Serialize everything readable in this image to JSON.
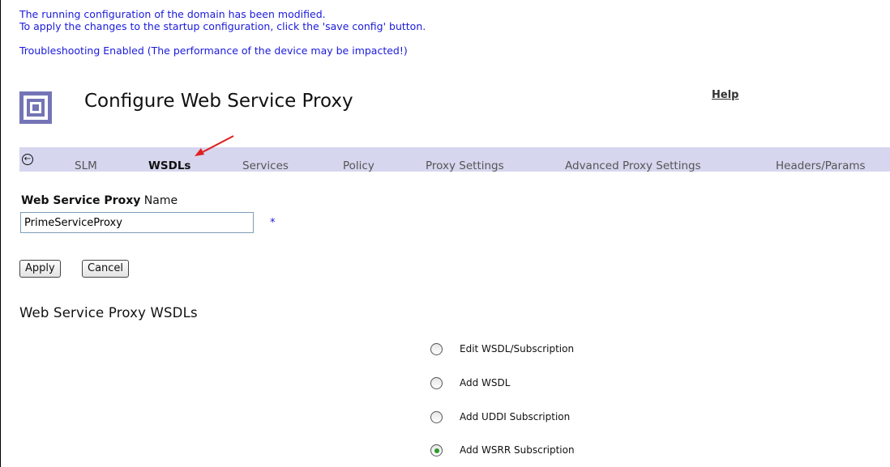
{
  "messages": {
    "line1": "The running configuration of the domain has been modified.",
    "line2": "To apply the changes to the startup configuration, click the 'save config' button.",
    "line3": "Troubleshooting Enabled (The performance of the device may be impacted!)"
  },
  "header": {
    "title": "Configure Web Service Proxy",
    "help": "Help"
  },
  "tabs": [
    {
      "label": "SLM",
      "active": false
    },
    {
      "label": "WSDLs",
      "active": true
    },
    {
      "label": "Services",
      "active": false
    },
    {
      "label": "Policy",
      "active": false
    },
    {
      "label": "Proxy Settings",
      "active": false
    },
    {
      "label": "Advanced Proxy Settings",
      "active": false
    },
    {
      "label": "Headers/Params",
      "active": false
    }
  ],
  "back_icon": "back-arrow-icon",
  "form": {
    "label_bold": "Web Service Proxy",
    "label_rest": " Name",
    "name_value": "PrimeServiceProxy",
    "required_mark": "*"
  },
  "buttons": {
    "apply": "Apply",
    "cancel": "Cancel"
  },
  "section": {
    "title": "Web Service Proxy WSDLs"
  },
  "options": [
    {
      "label": "Edit WSDL/Subscription",
      "selected": false
    },
    {
      "label": "Add WSDL",
      "selected": false
    },
    {
      "label": "Add UDDI Subscription",
      "selected": false
    },
    {
      "label": "Add WSRR Subscription",
      "selected": true
    }
  ],
  "colors": {
    "message": "#1a1adb",
    "tabbar": "#d6d6ef",
    "logo": "#7474b6",
    "arrow": "#e02020",
    "radio_selected": "#2e9a2e"
  }
}
